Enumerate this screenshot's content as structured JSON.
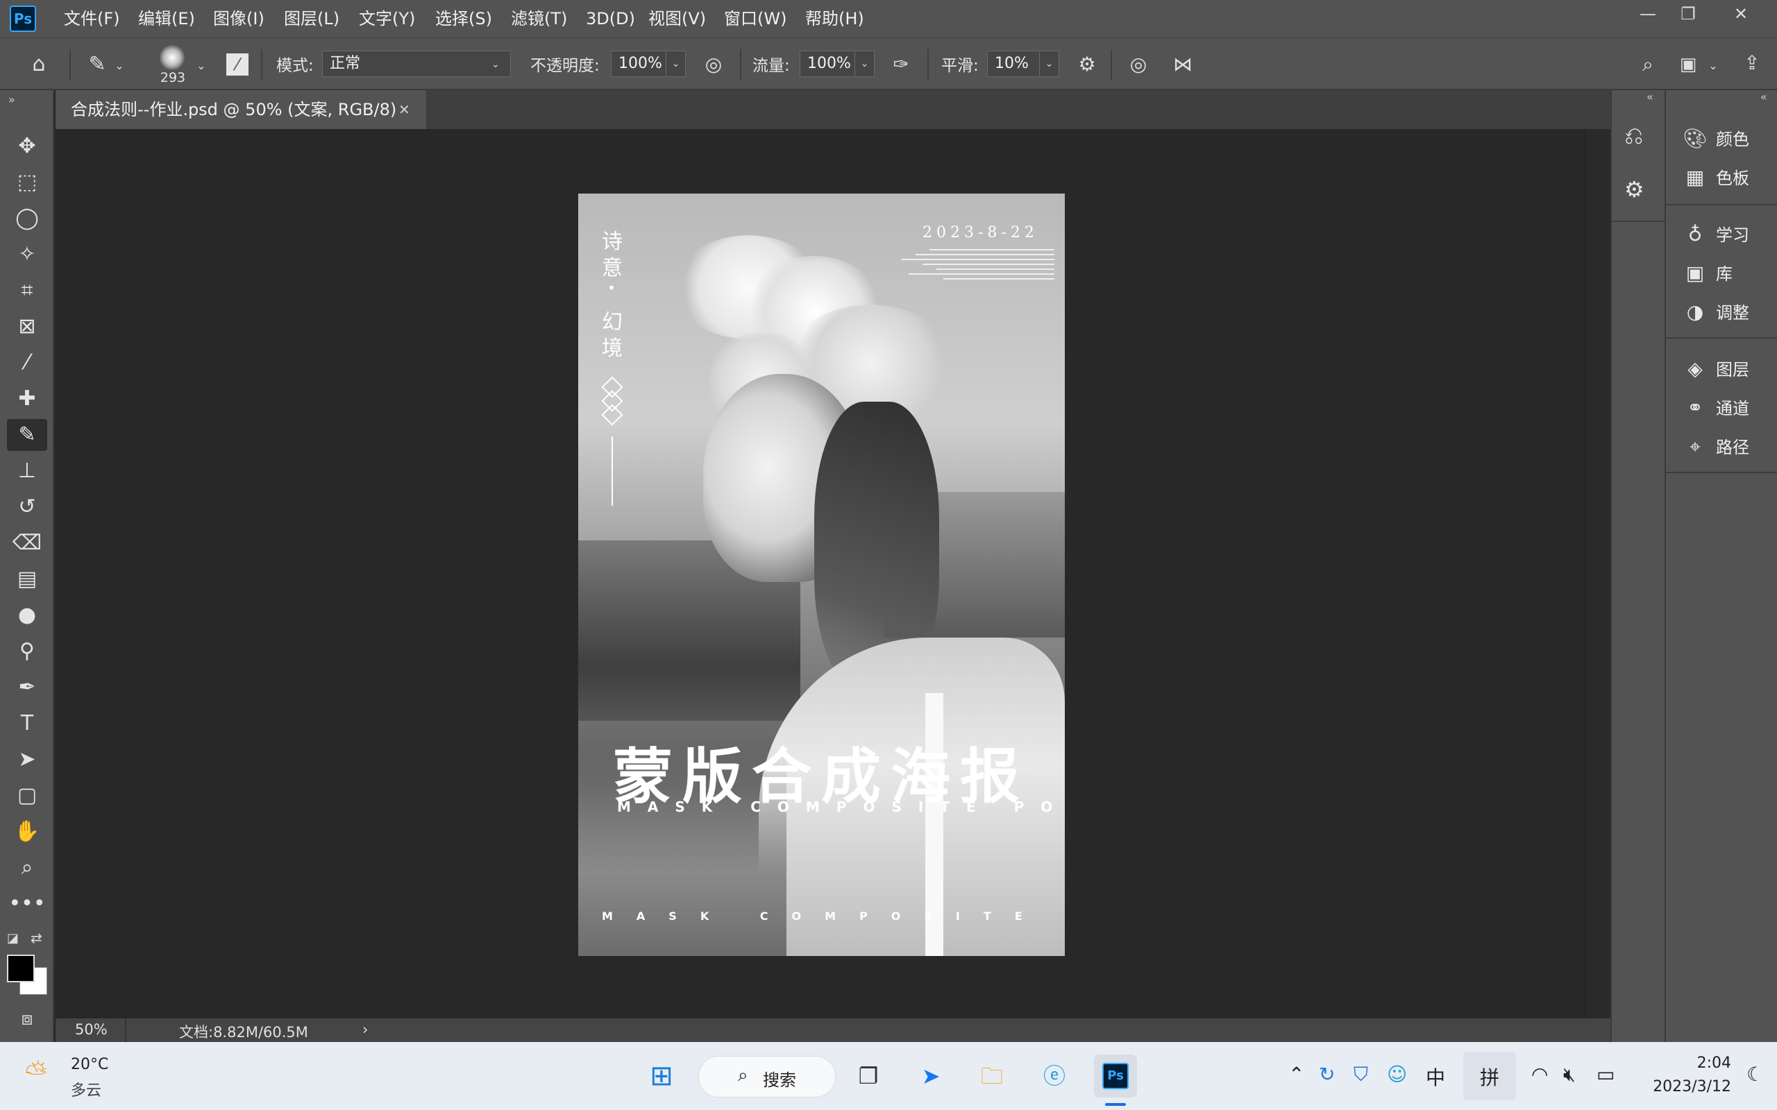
{
  "menubar": {
    "logo": "Ps",
    "items": [
      "文件(F)",
      "编辑(E)",
      "图像(I)",
      "图层(L)",
      "文字(Y)",
      "选择(S)",
      "滤镜(T)",
      "3D(D)",
      "视图(V)",
      "窗口(W)",
      "帮助(H)"
    ]
  },
  "options": {
    "brush_size": "293",
    "mode_label": "模式:",
    "mode_value": "正常",
    "opacity_label": "不透明度:",
    "opacity_value": "100%",
    "flow_label": "流量:",
    "flow_value": "100%",
    "smooth_label": "平滑:",
    "smooth_value": "10%"
  },
  "document": {
    "tab_title": "合成法则--作业.psd @ 50% (文案, RGB/8)",
    "zoom": "50%",
    "doc_info": "文档:8.82M/60.5M"
  },
  "poster": {
    "date": "2023-8-22",
    "vertical_1": "诗",
    "vertical_2": "意",
    "vertical_dot": "•",
    "vertical_3": "幻",
    "vertical_4": "境",
    "title": "蒙版合成海报",
    "subtitle": "MASK COMPOSITE POSTER",
    "footer": "MASK COMPOSITE POSTER"
  },
  "panels": {
    "items": [
      "颜色",
      "色板",
      "学习",
      "库",
      "调整",
      "图层",
      "通道",
      "路径"
    ]
  },
  "taskbar": {
    "temperature": "20°C",
    "weather": "多云",
    "search": "搜索",
    "ime_lang": "中",
    "ime_mode": "拼",
    "time": "2:04",
    "date": "2023/3/12"
  }
}
